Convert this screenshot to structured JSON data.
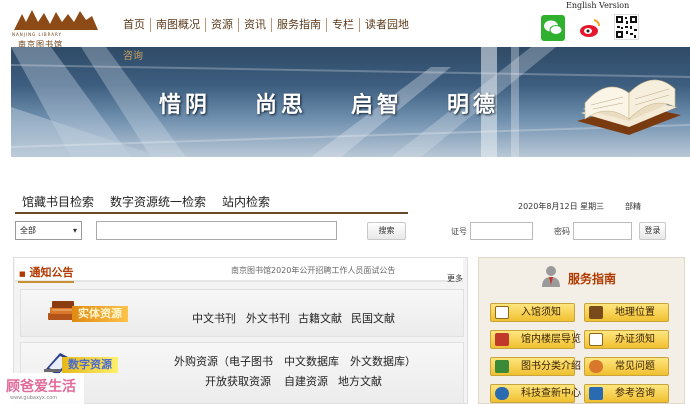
{
  "header": {
    "logo_en": "NANJING LIBRARY",
    "logo_cn": "南京图书馆",
    "english_link": "English Version",
    "nav": [
      "首页",
      "南图概况",
      "资源",
      "资讯",
      "服务指南",
      "专栏",
      "读者园地"
    ],
    "nav_overflow": "咨询"
  },
  "banner": {
    "slogan": [
      "惜阴",
      "尚思",
      "启智",
      "明德"
    ]
  },
  "search": {
    "tabs": [
      "馆藏书目检索",
      "数字资源统一检索",
      "站内检索"
    ],
    "scope": "全部",
    "query": "",
    "search_button": "搜索",
    "date": "2020年8月12日 星期三",
    "logout": "部精",
    "card_label": "证号",
    "password_label": "密码",
    "login_button": "登录"
  },
  "notice": {
    "title": "通知公告",
    "headline": "南京图书馆2020年公开招聘工作人员面试公告",
    "more": "更多"
  },
  "resources": {
    "physical": {
      "badge": "实体资源",
      "links": [
        "中文书刊",
        "外文书刊",
        "古籍文献",
        "民国文献"
      ]
    },
    "digital": {
      "badge": "数字资源",
      "line1": "外购资源（电子图书　中文数据库　外文数据库）",
      "links": [
        "开放获取资源",
        "自建资源",
        "地方文献"
      ]
    }
  },
  "services": {
    "title": "服务指南",
    "buttons": [
      "入馆须知",
      "地理位置",
      "馆内楼层导览",
      "办证须知",
      "图书分类介绍",
      "常见问题",
      "科技查新中心",
      "参考咨询"
    ]
  },
  "watermark": {
    "text": "顾爸爱生活",
    "sub": "www.gubaxyx.com"
  },
  "colors": {
    "brand_brown": "#6b3a12",
    "accent_red": "#b23a00",
    "service_gold": "#f0c030"
  }
}
